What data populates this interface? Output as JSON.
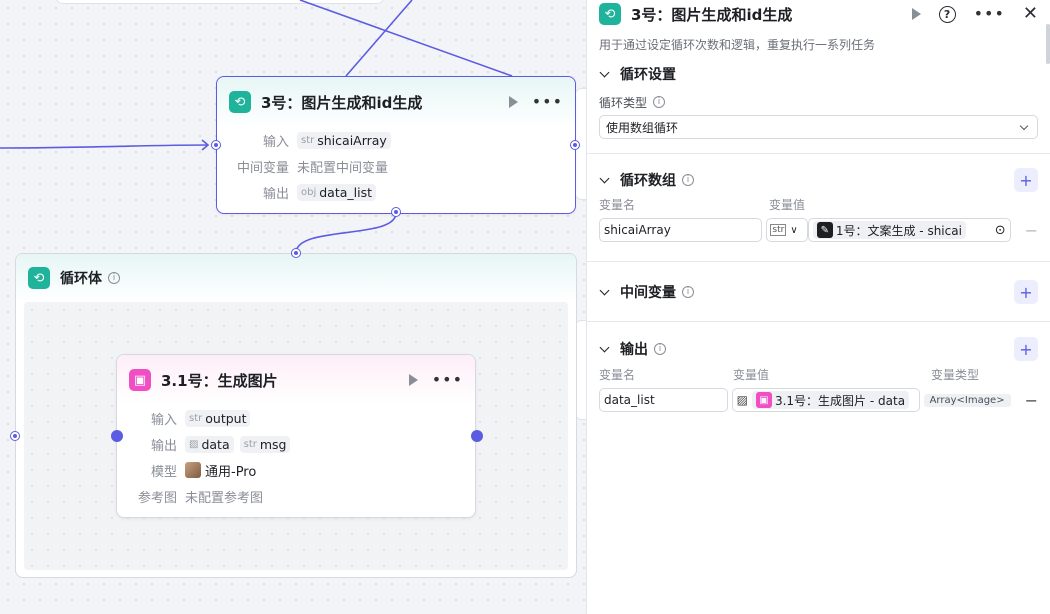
{
  "canvas": {
    "loop_node": {
      "title": "3号：图片生成和id生成",
      "rows": [
        {
          "label": "输入",
          "tag": "str",
          "value": "shicaiArray"
        },
        {
          "label": "中间变量",
          "value": "未配置中间变量"
        },
        {
          "label": "输出",
          "tag": "obj",
          "value": "data_list"
        }
      ]
    },
    "loop_body": {
      "title": "循环体"
    },
    "image_node": {
      "title": "3.1号：生成图片",
      "rows": {
        "input_label": "输入",
        "input_tag": "str",
        "input_value": "output",
        "output_label": "输出",
        "output_value1": "data",
        "output_tag2": "str",
        "output_value2": "msg",
        "model_label": "模型",
        "model_value": "通用-Pro",
        "ref_label": "参考图",
        "ref_value": "未配置参考图"
      }
    }
  },
  "panel": {
    "title": "3号：图片生成和id生成",
    "description": "用于通过设定循环次数和逻辑，重复执行一系列任务",
    "loop_settings": {
      "title": "循环设置",
      "type_label": "循环类型",
      "type_value": "使用数组循环"
    },
    "loop_array": {
      "title": "循环数组",
      "col_name": "变量名",
      "col_value": "变量值",
      "var_name": "shicaiArray",
      "type_tag": "str",
      "ref_text": "1号：文案生成 - shicai"
    },
    "intermediate": {
      "title": "中间变量"
    },
    "output": {
      "title": "输出",
      "col_name": "变量名",
      "col_value": "变量值",
      "col_type": "变量类型",
      "var_name": "data_list",
      "ref_text": "3.1号：生成图片 - data",
      "var_type": "Array<Image>"
    }
  },
  "colors": {
    "accent": "#5b5ce2",
    "loop_icon": "#1fb39b",
    "image_icon": "#f04ec2"
  }
}
